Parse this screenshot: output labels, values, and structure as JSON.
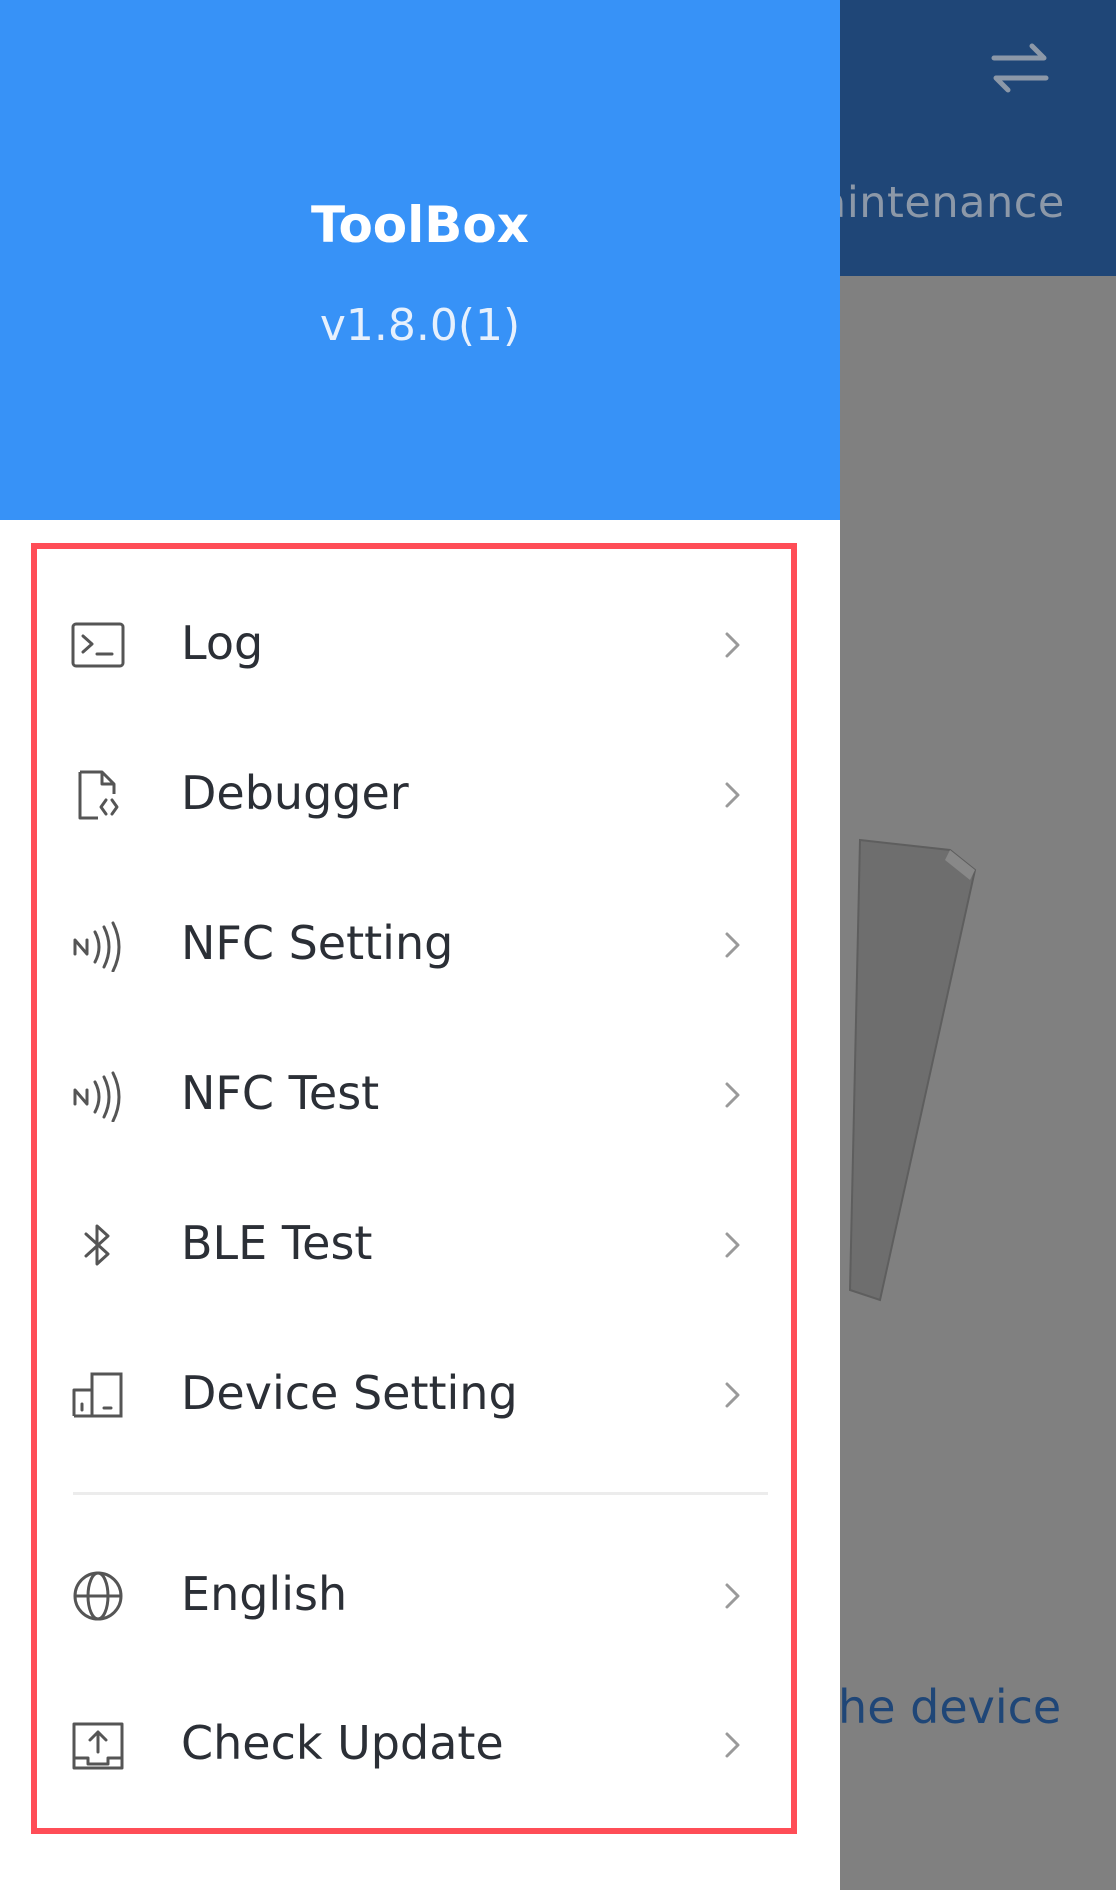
{
  "background": {
    "tab_label": "aintenance",
    "link_text": "the device",
    "header_color": "#1f4677",
    "swap_icon": "swap-arrows-icon"
  },
  "drawer": {
    "title": "ToolBox",
    "version": "v1.8.0(1)",
    "header_color": "#3792f7",
    "highlight_color": "#ff4d57",
    "items": [
      {
        "label": "Log",
        "icon": "terminal-icon"
      },
      {
        "label": "Debugger",
        "icon": "code-file-icon"
      },
      {
        "label": "NFC Setting",
        "icon": "nfc-icon"
      },
      {
        "label": "NFC Test",
        "icon": "nfc-icon"
      },
      {
        "label": "BLE Test",
        "icon": "bluetooth-icon"
      },
      {
        "label": "Device Setting",
        "icon": "device-icon"
      },
      {
        "label": "English",
        "icon": "globe-icon"
      },
      {
        "label": "Check Update",
        "icon": "upload-icon"
      }
    ]
  }
}
